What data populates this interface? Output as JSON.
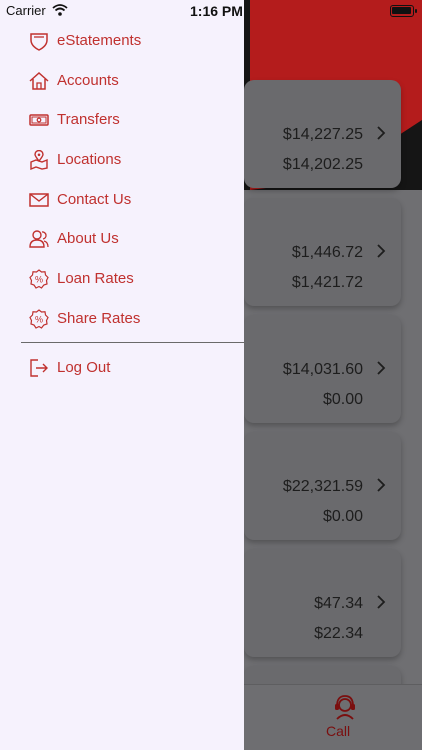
{
  "status_bar": {
    "carrier": "Carrier",
    "time": "1:16 PM"
  },
  "drawer": {
    "items": [
      {
        "label": "eStatements",
        "icon": "shield-icon"
      },
      {
        "label": "Accounts",
        "icon": "home-icon"
      },
      {
        "label": "Transfers",
        "icon": "money-icon"
      },
      {
        "label": "Locations",
        "icon": "map-icon"
      },
      {
        "label": "Contact Us",
        "icon": "mail-icon"
      },
      {
        "label": "About Us",
        "icon": "people-icon"
      },
      {
        "label": "Loan Rates",
        "icon": "percent-badge-icon"
      },
      {
        "label": "Share Rates",
        "icon": "percent-badge-icon"
      }
    ],
    "logout": {
      "label": "Log Out",
      "icon": "logout-icon"
    }
  },
  "accounts": [
    {
      "balance": "$14,227.25",
      "available": "$14,202.25"
    },
    {
      "balance": "$1,446.72",
      "available": "$1,421.72"
    },
    {
      "balance": "$14,031.60",
      "available": "$0.00"
    },
    {
      "balance": "$22,321.59",
      "available": "$0.00"
    },
    {
      "balance": "$47.34",
      "available": "$22.34"
    }
  ],
  "tabbar": {
    "call_label": "Call"
  },
  "colors": {
    "accent": "#c0312f",
    "drawer_bg": "#f6f2fd",
    "dim_bg": "#6f6f72"
  }
}
